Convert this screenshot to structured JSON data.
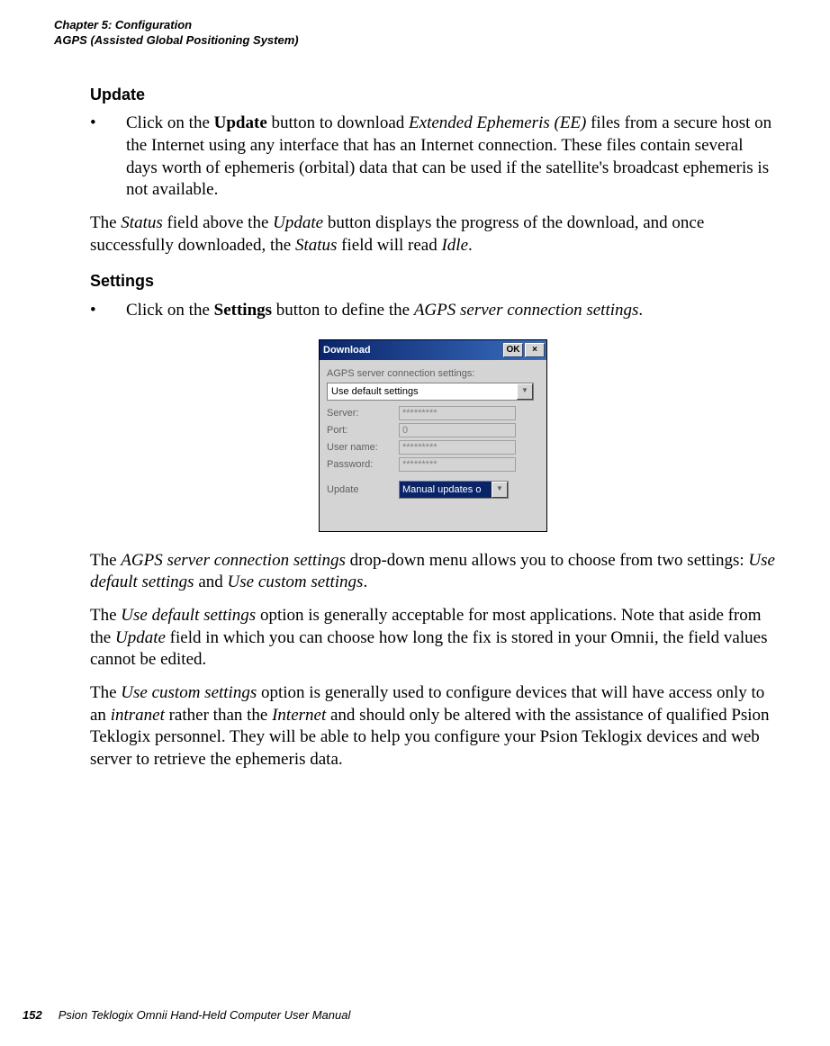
{
  "header": {
    "line1": "Chapter 5:  Configuration",
    "line2": "AGPS (Assisted Global Positioning System)"
  },
  "section1": {
    "heading": "Update",
    "bullet_prefix": "Click on the ",
    "bullet_bold": "Update",
    "bullet_mid": " button to download ",
    "bullet_italic": "Extended Ephemeris (EE)",
    "bullet_suffix": " files from a secure host on the Internet using any interface that has an Internet connection. These files contain several days worth of ephemeris (orbital) data that can be used if the satellite's broadcast ephemeris is not available.",
    "para_p1": "The ",
    "para_i1": "Status",
    "para_p2": " field above the ",
    "para_i2": "Update",
    "para_p3": " button displays the progress of the download, and once successfully downloaded, the ",
    "para_i3": "Status",
    "para_p4": " field will read ",
    "para_i4": "Idle",
    "para_p5": "."
  },
  "section2": {
    "heading": "Settings",
    "bullet_prefix": "Click on the ",
    "bullet_bold": "Settings",
    "bullet_mid": " button to define the ",
    "bullet_italic": "AGPS server connection settings",
    "bullet_suffix": "."
  },
  "dialog": {
    "title": "Download",
    "ok": "OK",
    "close": "×",
    "top_label": "AGPS server connection settings:",
    "dropdown_value": "Use default settings",
    "server_label": "Server:",
    "server_value": "*********",
    "port_label": "Port:",
    "port_value": "0",
    "user_label": "User name:",
    "user_value": "*********",
    "pass_label": "Password:",
    "pass_value": "*********",
    "update_label": "Update",
    "update_value": "Manual updates o",
    "arrow": "▼"
  },
  "para3": {
    "p1": "The ",
    "i1": "AGPS server connection settings",
    "p2": " drop-down menu allows you to choose from two settings: ",
    "i2": "Use default settings",
    "p3": " and ",
    "i3": "Use custom settings",
    "p4": "."
  },
  "para4": {
    "p1": "The ",
    "i1": "Use default settings",
    "p2": " option is generally acceptable for most applications. Note that aside from the ",
    "i2": "Update",
    "p3": " field in which you can choose how long the fix is stored in your Omnii, the field values cannot be edited."
  },
  "para5": {
    "p1": "The ",
    "i1": "Use custom settings",
    "p2": " option is generally used to configure devices that will have access only to an ",
    "i2": "intranet",
    "p3": " rather than the ",
    "i3": "Internet",
    "p4": " and should only be altered with the assistance of qualified Psion Teklogix personnel. They will be able to help you configure your Psion Teklogix devices and web server to retrieve the ephemeris data."
  },
  "footer": {
    "page": "152",
    "text": "Psion Teklogix Omnii Hand-Held Computer User Manual"
  }
}
